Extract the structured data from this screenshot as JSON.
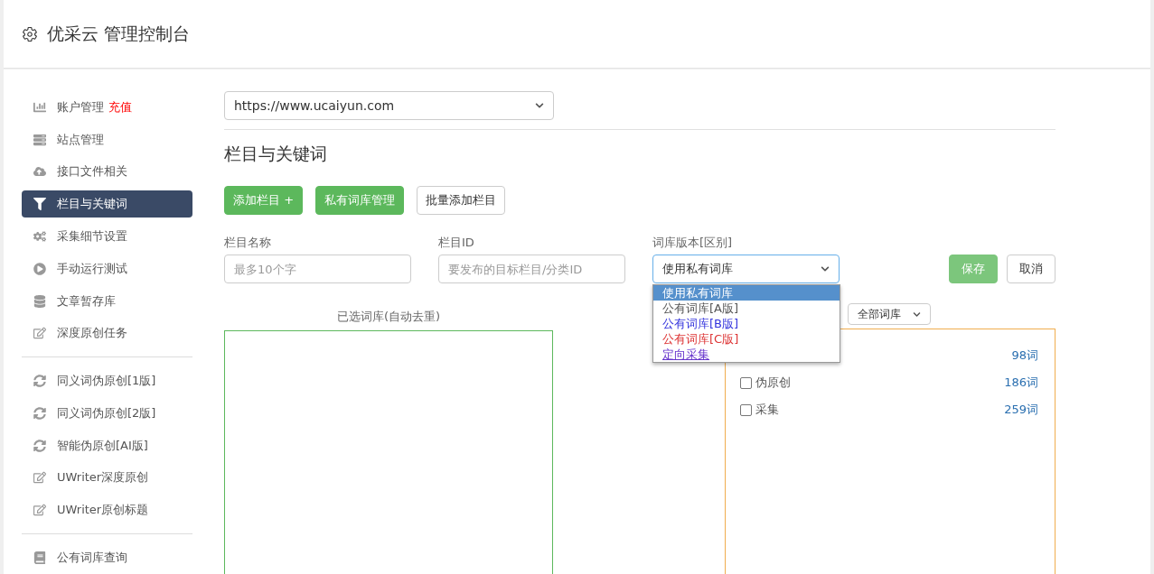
{
  "header": {
    "title": "优采云 管理控制台"
  },
  "sidebar": {
    "groups": [
      [
        {
          "label": "账户管理",
          "badge": "充值",
          "selected": false
        },
        {
          "label": "站点管理",
          "selected": false
        },
        {
          "label": "接口文件相关",
          "selected": false
        },
        {
          "label": "栏目与关键词",
          "selected": true
        },
        {
          "label": "采集细节设置",
          "selected": false
        },
        {
          "label": "手动运行测试",
          "selected": false
        },
        {
          "label": "文章暂存库",
          "selected": false
        },
        {
          "label": "深度原创任务",
          "selected": false
        }
      ],
      [
        {
          "label": "同义词伪原创[1版]",
          "selected": false
        },
        {
          "label": "同义词伪原创[2版]",
          "selected": false
        },
        {
          "label": "智能伪原创[AI版]",
          "selected": false
        },
        {
          "label": "UWriter深度原创",
          "selected": false
        },
        {
          "label": "UWriter原创标题",
          "selected": false
        }
      ],
      [
        {
          "label": "公有词库查询",
          "selected": false
        }
      ]
    ]
  },
  "site_select": {
    "value": "https://www.ucaiyun.com"
  },
  "section_title": "栏目与关键词",
  "buttons": [
    {
      "label": "添加栏目 +",
      "kind": "primary"
    },
    {
      "label": "私有词库管理",
      "kind": "primary"
    },
    {
      "label": "批量添加栏目",
      "kind": "default"
    }
  ],
  "form": {
    "fields": [
      {
        "label": "栏目名称",
        "placeholder": "最多10个字"
      },
      {
        "label": "栏目ID",
        "placeholder": "要发布的目标栏目/分类ID"
      }
    ],
    "version": {
      "label": "词库版本[区别]",
      "value": "使用私有词库",
      "expanded": true,
      "options": [
        {
          "label": "使用私有词库",
          "selected": true
        },
        {
          "label": "公有词库[A版]",
          "selected": false,
          "color": "#555555"
        },
        {
          "label": "公有词库[B版]",
          "selected": false,
          "color": "#3333dd"
        },
        {
          "label": "公有词库[C版]",
          "selected": false,
          "color": "#dd3333"
        },
        {
          "label": "定向采集",
          "selected": false,
          "color": "#6633cc"
        }
      ]
    },
    "save": "保存",
    "cancel": "取消"
  },
  "selected_panel": {
    "label": "已选词库(自动去重)"
  },
  "library_filter": {
    "value": "全部词库"
  },
  "libraries": [
    {
      "count": "98词"
    },
    {
      "label": "伪原创",
      "count": "186词",
      "checked": false
    },
    {
      "label": "采集",
      "count": "259词",
      "checked": false
    }
  ]
}
